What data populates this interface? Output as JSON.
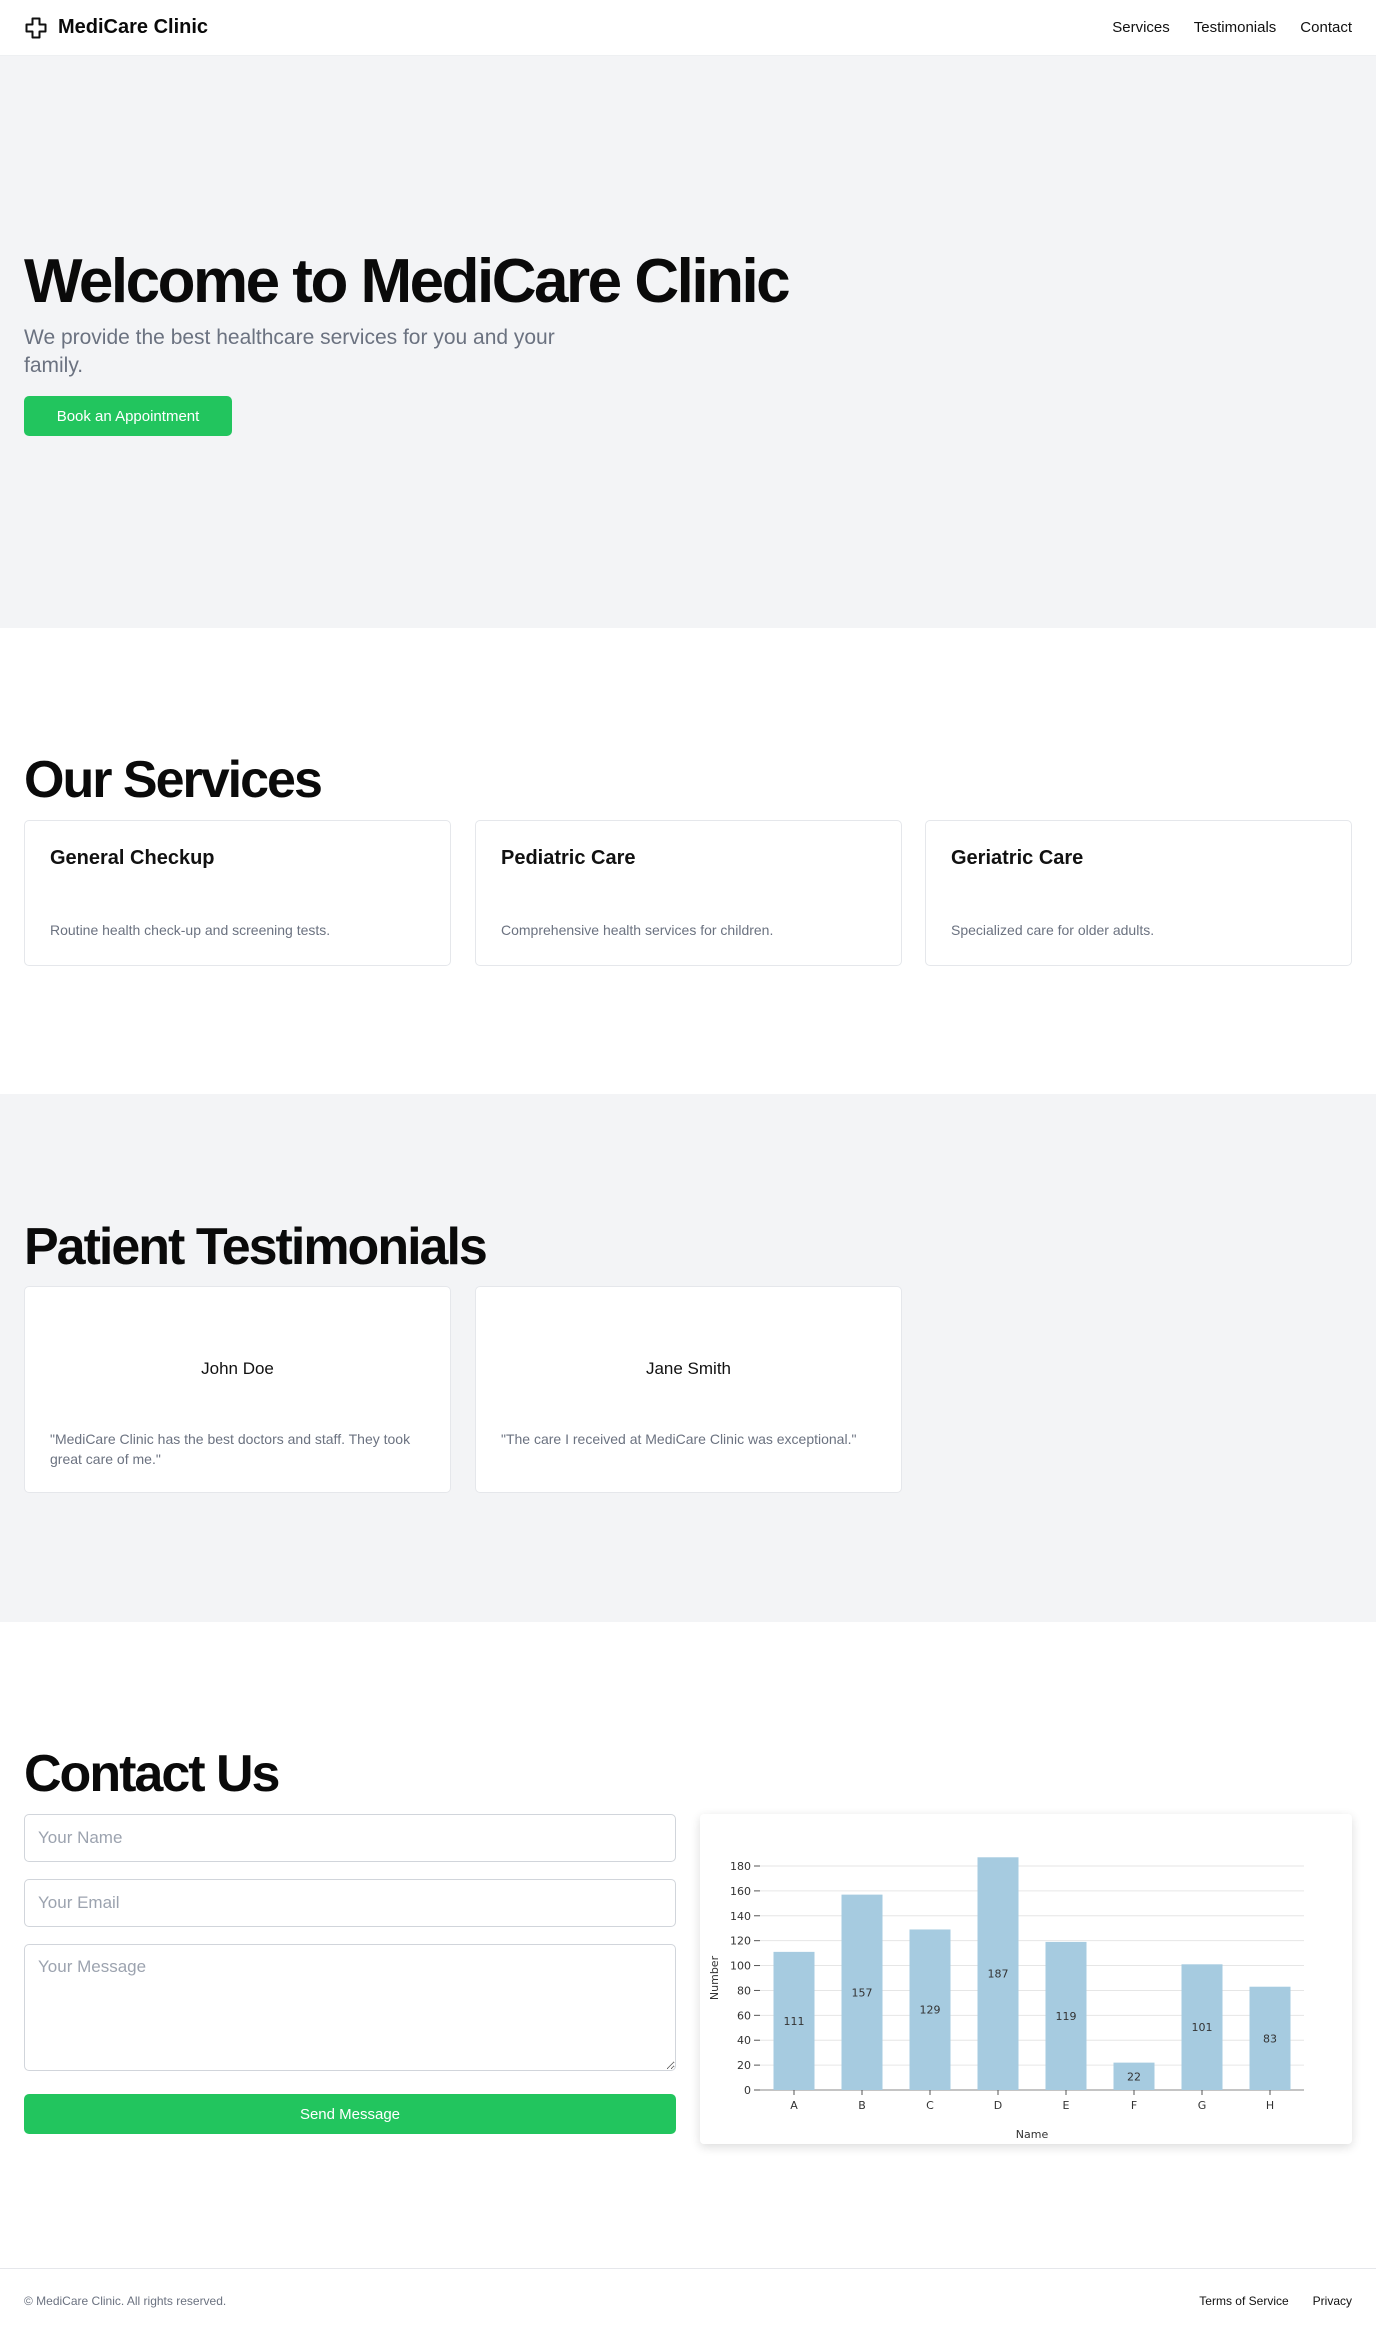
{
  "header": {
    "brand": "MediCare Clinic",
    "nav": [
      "Services",
      "Testimonials",
      "Contact"
    ]
  },
  "hero": {
    "title": "Welcome to MediCare Clinic",
    "subtitle": "We provide the best healthcare services for you and your family.",
    "cta": "Book an Appointment"
  },
  "services": {
    "heading": "Our Services",
    "items": [
      {
        "title": "General Checkup",
        "description": "Routine health check-up and screening tests."
      },
      {
        "title": "Pediatric Care",
        "description": "Comprehensive health services for children."
      },
      {
        "title": "Geriatric Care",
        "description": "Specialized care for older adults."
      }
    ]
  },
  "testimonials": {
    "heading": "Patient Testimonials",
    "items": [
      {
        "name": "John Doe",
        "quote": "\"MediCare Clinic has the best doctors and staff. They took great care of me.\""
      },
      {
        "name": "Jane Smith",
        "quote": "\"The care I received at MediCare Clinic was exceptional.\""
      }
    ]
  },
  "contact": {
    "heading": "Contact Us",
    "name_placeholder": "Your Name",
    "email_placeholder": "Your Email",
    "message_placeholder": "Your Message",
    "send_label": "Send Message"
  },
  "chart_data": {
    "type": "bar",
    "categories": [
      "A",
      "B",
      "C",
      "D",
      "E",
      "F",
      "G",
      "H"
    ],
    "values": [
      111,
      157,
      129,
      187,
      119,
      22,
      101,
      83
    ],
    "xlabel": "Name",
    "ylabel": "Number",
    "ylim": [
      0,
      180
    ],
    "yticks": [
      0,
      20,
      40,
      60,
      80,
      100,
      120,
      140,
      160,
      180
    ],
    "grid": true,
    "bar_color": "#a6cbe0"
  },
  "footer": {
    "copyright": "© MediCare Clinic. All rights reserved.",
    "links": [
      "Terms of Service",
      "Privacy"
    ]
  },
  "colors": {
    "accent": "#22c55e",
    "section_bg": "#f3f4f6",
    "muted_text": "#6b7280"
  }
}
